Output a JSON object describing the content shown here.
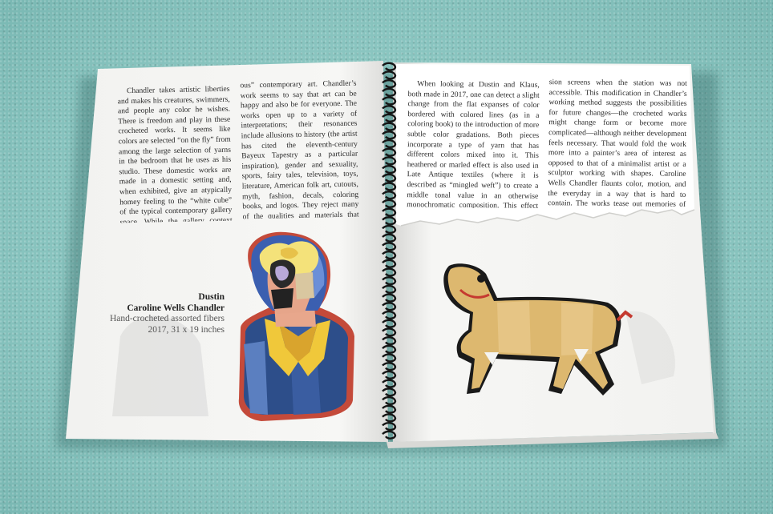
{
  "left_page": {
    "column1": "Chandler takes artistic liberties and makes his creatures, swimmers, and people any color he wishes. There is freedom and play in these crocheted works. It seems like colors are selected “on the fly” from among the large selection of yarns in the bedroom that he uses as his studio. These domestic works are made in a domestic setting and, when exhibited, give an atypically homey feeling to the “white cube” of the typical contemporary gallery space. While the gallery context elevates them to the status of “high art,” they seem to resist both the predominant hierarchy of artistic media and the hierarchy of cultural education that guard the boundaries of “seri-",
    "column2": "ous” contemporary art. Chandler’s work seems to say that art can be happy and also be for everyone. The works open up to a variety of interpretations; their resonances include allusions to history (the artist has cited the eleventh-century Bayeux Tapestry as a particular inspiration), gender and sexuality, sports, fairy tales, television, toys, literature, American folk art, cutouts, myth, fashion, decals, coloring books, and logos. They reject many of the qualities and materials that frame art as a serious endeavor that requires a great deal of training and education. The forms remind me of how a weekend hobbyist might approach choosing a form for a collection of wooden lawn."
  },
  "caption": {
    "title": "Dustin",
    "artist": "Caroline Wells Chandler",
    "medium": "Hand-crocheted assorted fibers",
    "dims": "2017, 31 x 19 inches"
  },
  "right_page": {
    "column1": "When looking at Dustin and Klaus, both made in 2017, one can detect a slight change from the flat expanses of color bordered with colored lines (as in a coloring book) to the introduction of more subtle color gradations. Both pieces incorporate a type of yarn that has different colors mixed into it. This heathered or marled effect is also used in Late Antique textiles (where it is described as “mingled weft”) to create a middle tonal value in an otherwise monochromatic composition. This effect gives some of Chandler’s recent work a more decorative and organic quality, akin to the skin of a leopard or giraffe—or perhaps it is similar to the static that used to appear on old televi-",
    "column2": "sion screens when the station was not accessible. This modification in Chandler’s working method suggests the possibilities for future changes—the crocheted works might change form or become more complicated—although neither development feels necessary. That would fold the work more into a painter’s area of interest as opposed to that of a minimalist artist or a sculptor working with shapes. Caroline Wells Chandler flaunts color, motion, and the everyday in a way that is hard to contain. The works tease out memories of Eadweard Muybridge and his science-related photographic exercises with motion, which have been embraced by artists and art lovers alike."
  },
  "colors": {
    "background": "#8fc9c4",
    "page": "#f6f6f4",
    "ink": "#2a2a2a",
    "spiral": "#151515"
  }
}
